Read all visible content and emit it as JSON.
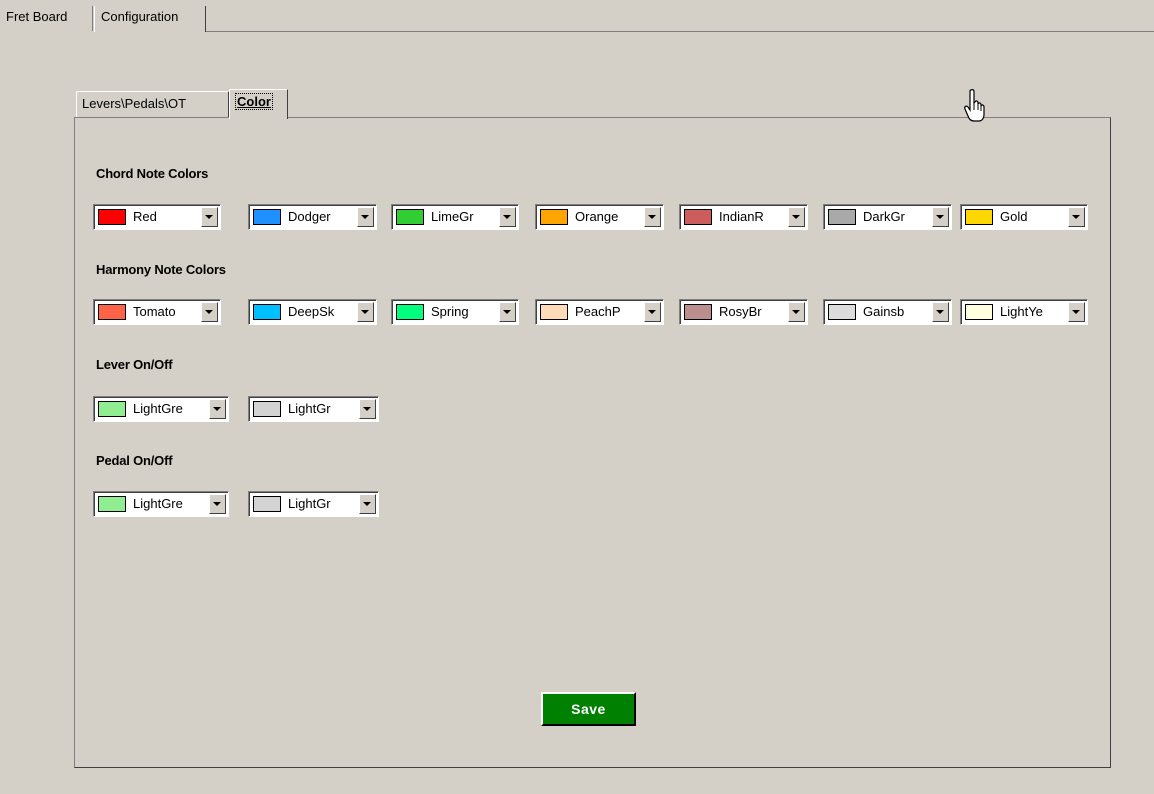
{
  "top_tabs": [
    "Fret Board",
    "Configuration"
  ],
  "inner_tabs": [
    "Levers\\Pedals\\OT",
    "Color"
  ],
  "sections": {
    "chord": {
      "title": "Chord Note Colors",
      "items": [
        {
          "name": "Red",
          "color": "#ff0000"
        },
        {
          "name": "Dodger",
          "color": "#1e90ff"
        },
        {
          "name": "LimeGr",
          "color": "#32cd32"
        },
        {
          "name": "Orange",
          "color": "#ffa500"
        },
        {
          "name": "IndianR",
          "color": "#cd5c5c"
        },
        {
          "name": "DarkGr",
          "color": "#a9a9a9"
        },
        {
          "name": "Gold",
          "color": "#ffd700"
        }
      ]
    },
    "harmony": {
      "title": "Harmony Note Colors",
      "items": [
        {
          "name": "Tomato",
          "color": "#ff6347"
        },
        {
          "name": "DeepSk",
          "color": "#00bfff"
        },
        {
          "name": "Spring",
          "color": "#00ff7f"
        },
        {
          "name": "PeachP",
          "color": "#ffdab9"
        },
        {
          "name": "RosyBr",
          "color": "#bc8f8f"
        },
        {
          "name": "Gainsb",
          "color": "#dcdcdc"
        },
        {
          "name": "LightYe",
          "color": "#ffffe0"
        }
      ]
    },
    "lever": {
      "title": "Lever On/Off",
      "items": [
        {
          "name": "LightGre",
          "color": "#90ee90"
        },
        {
          "name": "LightGr",
          "color": "#d3d3d3"
        }
      ]
    },
    "pedal": {
      "title": "Pedal On/Off",
      "items": [
        {
          "name": "LightGre",
          "color": "#90ee90"
        },
        {
          "name": "LightGr",
          "color": "#d3d3d3"
        }
      ]
    }
  },
  "save_label": "Save",
  "colors": {
    "background": "#d4d0c8",
    "save_button": "#008000"
  },
  "icons": {
    "cursor": "hand-pointer-icon",
    "dropdown": "chevron-down-icon"
  }
}
